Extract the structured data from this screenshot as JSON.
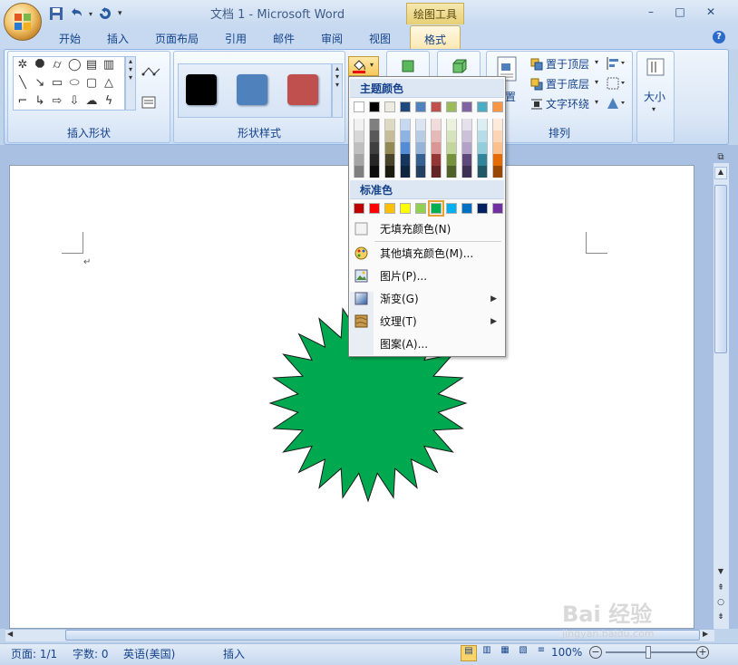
{
  "title_bar": {
    "document_title": "文档 1 - Microsoft Word",
    "context_tab_label": "绘图工具",
    "minimize": "–",
    "restore": "□",
    "close": "✕"
  },
  "tabs": [
    {
      "label": "开始"
    },
    {
      "label": "插入"
    },
    {
      "label": "页面布局"
    },
    {
      "label": "引用"
    },
    {
      "label": "邮件"
    },
    {
      "label": "审阅"
    },
    {
      "label": "视图"
    },
    {
      "label": "格式",
      "active": true
    }
  ],
  "ribbon": {
    "insert_shapes": {
      "label": "插入形状"
    },
    "shape_styles": {
      "label": "形状样式",
      "swatches": [
        "#000000",
        "#4f81bd",
        "#c0504d"
      ]
    },
    "arrange": {
      "label": "排列",
      "bring_front": "置于顶层",
      "send_back": "置于底层",
      "text_wrap": "文字环绕",
      "position_fragment": "置"
    },
    "size": {
      "label": "大小"
    }
  },
  "dropdown": {
    "theme_colors_header": "主题颜色",
    "theme_top_row": [
      "#ffffff",
      "#000000",
      "#eeece1",
      "#1f497d",
      "#4f81bd",
      "#c0504d",
      "#9bbb59",
      "#8064a2",
      "#4bacc6",
      "#f79646"
    ],
    "theme_shades": [
      [
        "#f2f2f2",
        "#7f7f7f",
        "#ddd9c3",
        "#c6d9f0",
        "#dbe5f1",
        "#f2dcdb",
        "#ebf1dd",
        "#e5e0ec",
        "#dbeef3",
        "#fdeada"
      ],
      [
        "#d8d8d8",
        "#595959",
        "#c4bd97",
        "#8db3e2",
        "#b8cce4",
        "#e5b9b7",
        "#d7e3bc",
        "#ccc1d9",
        "#b7dde8",
        "#fbd5b5"
      ],
      [
        "#bfbfbf",
        "#3f3f3f",
        "#938953",
        "#548dd4",
        "#95b3d7",
        "#d99694",
        "#c3d69b",
        "#b2a2c7",
        "#92cddc",
        "#fac08f"
      ],
      [
        "#a5a5a5",
        "#262626",
        "#494429",
        "#17365d",
        "#366092",
        "#953734",
        "#76923c",
        "#5f497a",
        "#31859b",
        "#e36c09"
      ],
      [
        "#7f7f7f",
        "#0c0c0c",
        "#1d1b10",
        "#0f243e",
        "#244061",
        "#632423",
        "#4f6128",
        "#3f3151",
        "#205867",
        "#974806"
      ]
    ],
    "standard_colors_header": "标准色",
    "standard_colors": [
      "#c00000",
      "#ff0000",
      "#ffc000",
      "#ffff00",
      "#92d050",
      "#00b050",
      "#00b0f0",
      "#0070c0",
      "#002060",
      "#7030a0"
    ],
    "selected_standard_index": 5,
    "items": [
      {
        "label": "无填充颜色(N)",
        "icon": "no-fill-icon"
      },
      {
        "label": "其他填充颜色(M)...",
        "icon": "palette-icon"
      },
      {
        "label": "图片(P)...",
        "icon": "picture-icon"
      },
      {
        "label": "渐变(G)",
        "icon": "gradient-icon",
        "submenu": true
      },
      {
        "label": "纹理(T)",
        "icon": "texture-icon",
        "submenu": true
      },
      {
        "label": "图案(A)...",
        "icon": "",
        "submenu": false
      }
    ]
  },
  "document": {
    "shape_fill_color": "#00a84f",
    "paragraph_mark": "↵"
  },
  "status_bar": {
    "page": "页面: 1/1",
    "word_count": "字数: 0",
    "language": "英语(美国)",
    "mode": "插入",
    "zoom": "100%"
  },
  "watermark": "Bai 经验",
  "watermark_sub": "jingyan.baidu.com"
}
